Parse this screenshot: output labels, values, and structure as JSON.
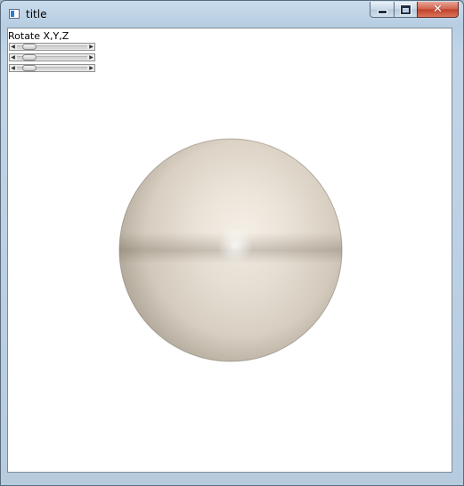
{
  "window": {
    "title": "title",
    "caption_buttons": {
      "minimize_icon": "minimize-icon",
      "maximize_icon": "maximize-icon",
      "close_icon": "close-icon",
      "close_glyph": "✕"
    }
  },
  "controls": {
    "label": "Rotate X,Y,Z",
    "sliders": [
      {
        "axis": "X",
        "value": 0.1
      },
      {
        "axis": "Y",
        "value": 0.1
      },
      {
        "axis": "Z",
        "value": 0.1
      }
    ],
    "left_arrow": "◀",
    "right_arrow": "▶"
  },
  "scene": {
    "object": "sphere",
    "colors": {
      "light": "#fbf5ec",
      "mid": "#e4dccf",
      "shadow": "#8d8474",
      "background": "#ffffff"
    }
  }
}
